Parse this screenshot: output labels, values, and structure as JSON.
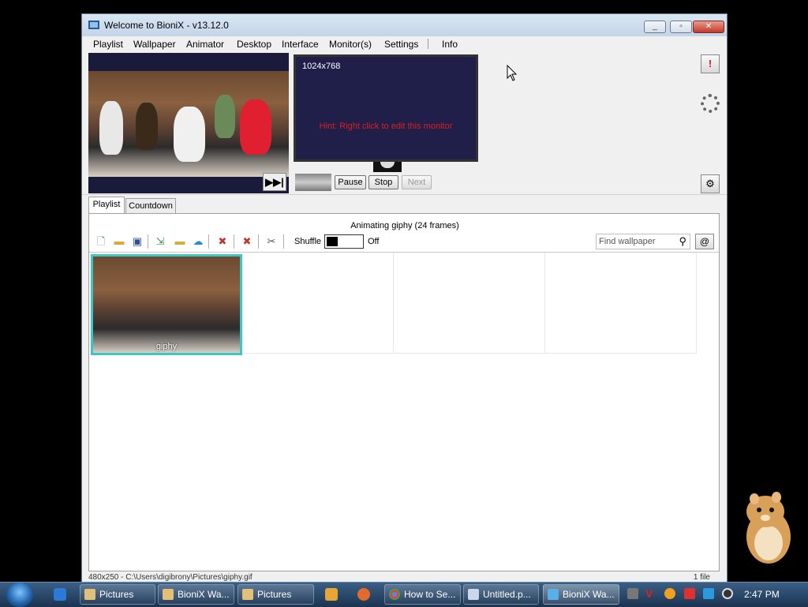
{
  "window": {
    "title": "Welcome to BioniX -  v13.12.0",
    "controls": {
      "minimize": "▭",
      "maximize": "▭",
      "close": "✕"
    }
  },
  "menu": [
    "Playlist",
    "Wallpaper",
    "Animator",
    "Desktop",
    "Interface",
    "Monitor(s)",
    "Settings",
    "Info"
  ],
  "preview": {
    "skip_icon": "skip-forward-icon",
    "skip_label": "▶▶|"
  },
  "monitor": {
    "resolution": "1024x768",
    "hint": "Hint: Right click to edit this monitor",
    "hint_color": "#e21c1c"
  },
  "controls": {
    "pause": "Pause",
    "stop": "Stop",
    "next": "Next"
  },
  "side_buttons": {
    "alert": "!",
    "settings": "⚙"
  },
  "tabs": [
    "Playlist",
    "Countdown"
  ],
  "panel": {
    "status": "Animating giphy  (24 frames)",
    "shuffle_label": "Shuffle",
    "shuffle_state": "Off",
    "search_placeholder": "Find wallpaper",
    "at_label": "@"
  },
  "toolbar_icons": [
    "new-icon",
    "open-folder-icon",
    "save-icon",
    "import-icon",
    "add-folder-icon",
    "download-cloud-icon",
    "delete-icon",
    "remove-icon",
    "tools-icon"
  ],
  "items": [
    {
      "label": "giphy",
      "selected": true
    }
  ],
  "statusbar": {
    "left": "480x250 - C:\\Users\\digibrony\\Pictures\\giphy.gif",
    "right": "1 file"
  },
  "taskbar": {
    "buttons": [
      {
        "label": "Pictures",
        "icon": "folder-icon"
      },
      {
        "label": "BioniX Wa...",
        "icon": "folder-icon"
      },
      {
        "label": "Pictures",
        "icon": "folder-icon"
      },
      {
        "label": "How to Se...",
        "icon": "chrome-icon"
      },
      {
        "label": "Untitled.p...",
        "icon": "paint-icon"
      },
      {
        "label": "BioniX Wa...",
        "icon": "bionix-icon",
        "active": true
      }
    ],
    "clock": "2:47 PM"
  },
  "colors": {
    "selection": "#3cc6c6",
    "monitor_bg": "#1f1f4a"
  }
}
